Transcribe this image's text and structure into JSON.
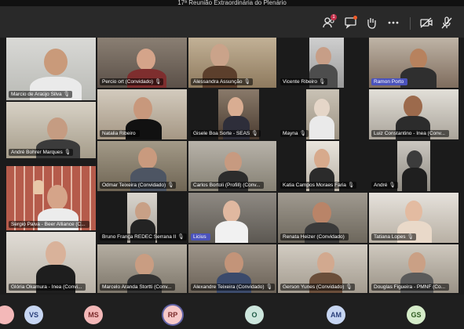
{
  "window": {
    "title": "17ª Reunião Extraordinária do Plenário"
  },
  "toolbar": {
    "icons": [
      "people-icon",
      "chat-icon",
      "raise-hand-icon",
      "more-icon",
      "camera-off-icon",
      "mic-off-icon"
    ],
    "people_badge": "1"
  },
  "participants": [
    {
      "name": "Marcio de Araújo Silva",
      "mic": "🎙"
    },
    {
      "name": "Percio ort (Convidado)",
      "mic": "🎙"
    },
    {
      "name": "Alessandra Assunção",
      "mic": "🎙"
    },
    {
      "name": "Vicente Ribeiro",
      "mic": "🎙"
    },
    {
      "name": "Ramon Porto",
      "mic": ""
    },
    {
      "name": "André Bohrer Marques",
      "mic": "🎙"
    },
    {
      "name": "Natalia Ribeiro",
      "mic": ""
    },
    {
      "name": "Gisele Boa Sorte - SEAS",
      "mic": "🎙"
    },
    {
      "name": "Mayna",
      "mic": "🎙"
    },
    {
      "name": "Luiz Constantino - Inea (Conv...",
      "mic": ""
    },
    {
      "name": "Odmar Teixeira (Convidado)",
      "mic": "🎙"
    },
    {
      "name": "Carlos Bortoli (Profill) (Conv...",
      "mic": ""
    },
    {
      "name": "Katia Campos Moraes Faria",
      "mic": "🎙"
    },
    {
      "name": "André",
      "mic": "🎙"
    },
    {
      "name": "Sergio Paiva - Beer Alliance (C...",
      "mic": ""
    },
    {
      "name": "Bruno França REDEC Serrana II",
      "mic": "🎙"
    },
    {
      "name": "Licius",
      "mic": ""
    },
    {
      "name": "Renata Heizer (Convidado)",
      "mic": ""
    },
    {
      "name": "Tatiana Lopes",
      "mic": "🎙"
    },
    {
      "name": "Glória Okamura - Inea (Convi...",
      "mic": ""
    },
    {
      "name": "Marcelo Aranda Stortti (Conv...",
      "mic": ""
    },
    {
      "name": "Alexandre Teixeira (Convidado)",
      "mic": "🎙"
    },
    {
      "name": "Gerson Yunes (Convidado)",
      "mic": "🎙"
    },
    {
      "name": "Douglas Figueira - PMNF (Co...",
      "mic": ""
    }
  ],
  "bottom_avatars": [
    {
      "initials": "",
      "label": "",
      "color": "#f3b8b8"
    },
    {
      "initials": "VS",
      "label": "",
      "color": "#c7d6f2"
    },
    {
      "initials": "MS",
      "label": "",
      "color": "#f3b8b8"
    },
    {
      "initials": "RP",
      "label": "",
      "color": "#f7c9c9"
    },
    {
      "initials": "O",
      "label": "",
      "color": "#cde6dd"
    },
    {
      "initials": "AM",
      "label": "",
      "color": "#c7d6f2"
    },
    {
      "initials": "GS",
      "label": "",
      "color": "#d5ecc9"
    }
  ]
}
